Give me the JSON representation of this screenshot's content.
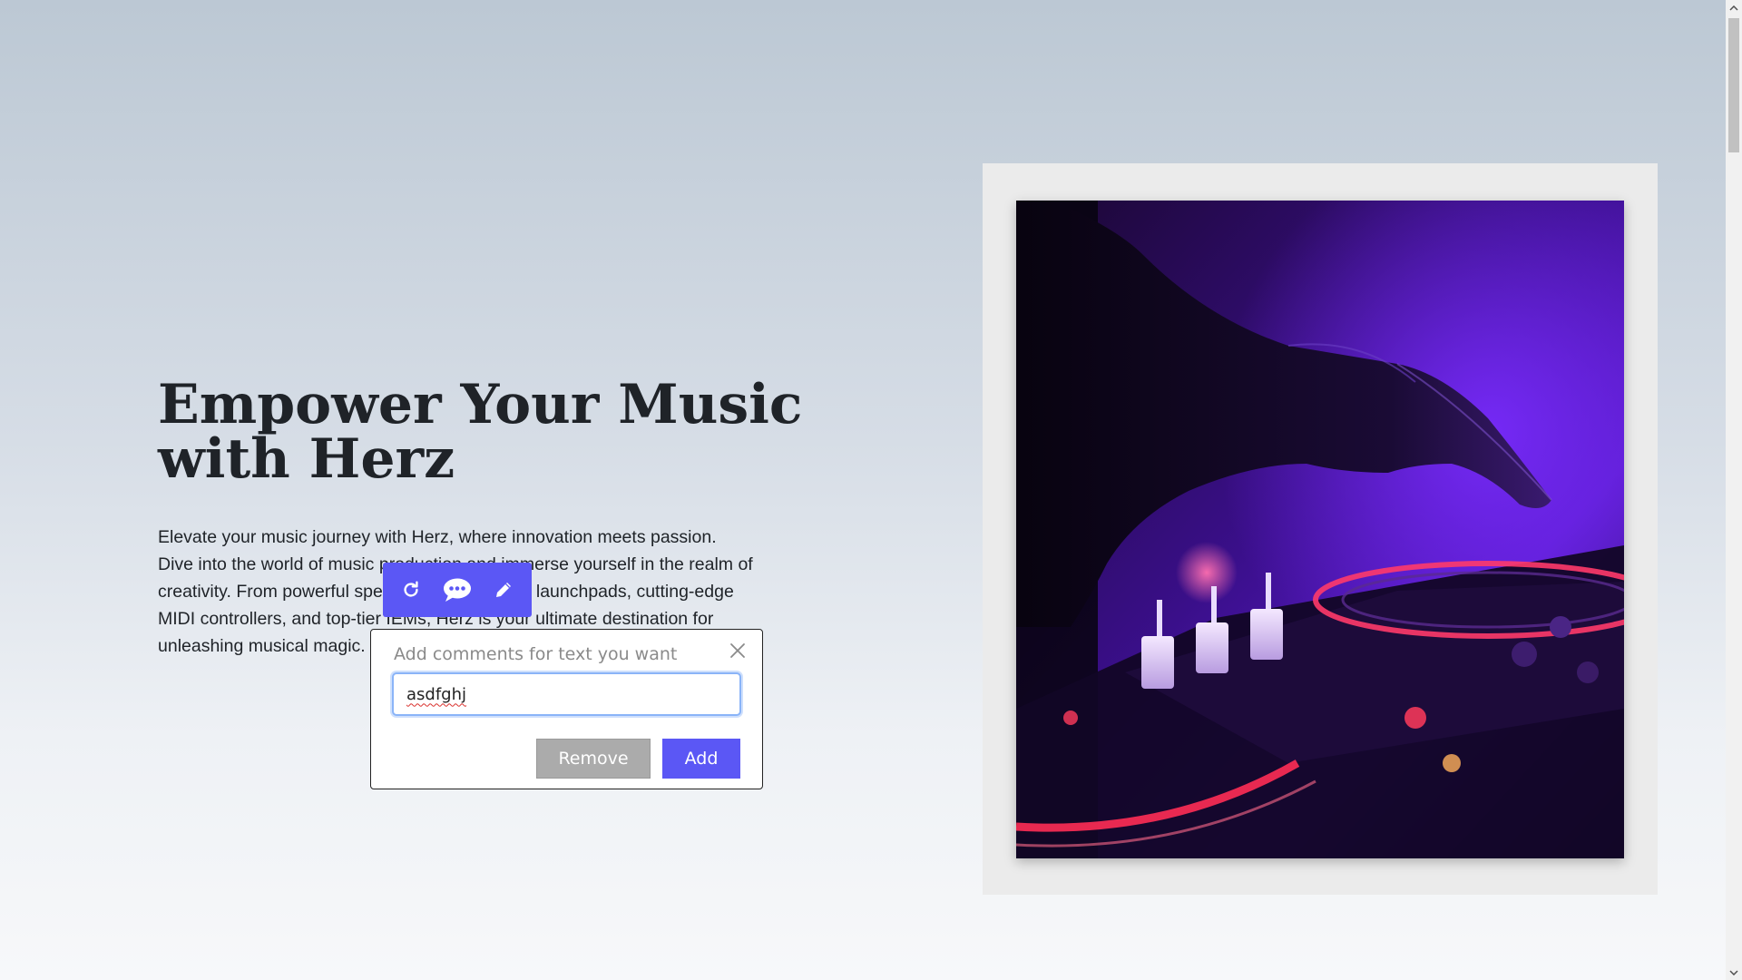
{
  "hero": {
    "title": "Empower Your Music with Herz",
    "description": "Elevate your music journey with Herz, where innovation meets passion. Dive into the world of music production and immerse yourself in the realm of creativity. From powerful speakers and dynamic launchpads, cutting-edge MIDI controllers, and top-tier IEMs, Herz is your ultimate destination for unleashing musical magic."
  },
  "toolbar": {
    "icons": [
      "refresh-icon",
      "comment-icon",
      "pencil-icon"
    ]
  },
  "comment_popover": {
    "title": "Add comments for text you want",
    "input_value": "asdfghj",
    "remove_label": "Remove",
    "add_label": "Add"
  },
  "colors": {
    "accent": "#5b57f5",
    "remove_button": "#ababab",
    "heading_text": "#1f2328"
  }
}
